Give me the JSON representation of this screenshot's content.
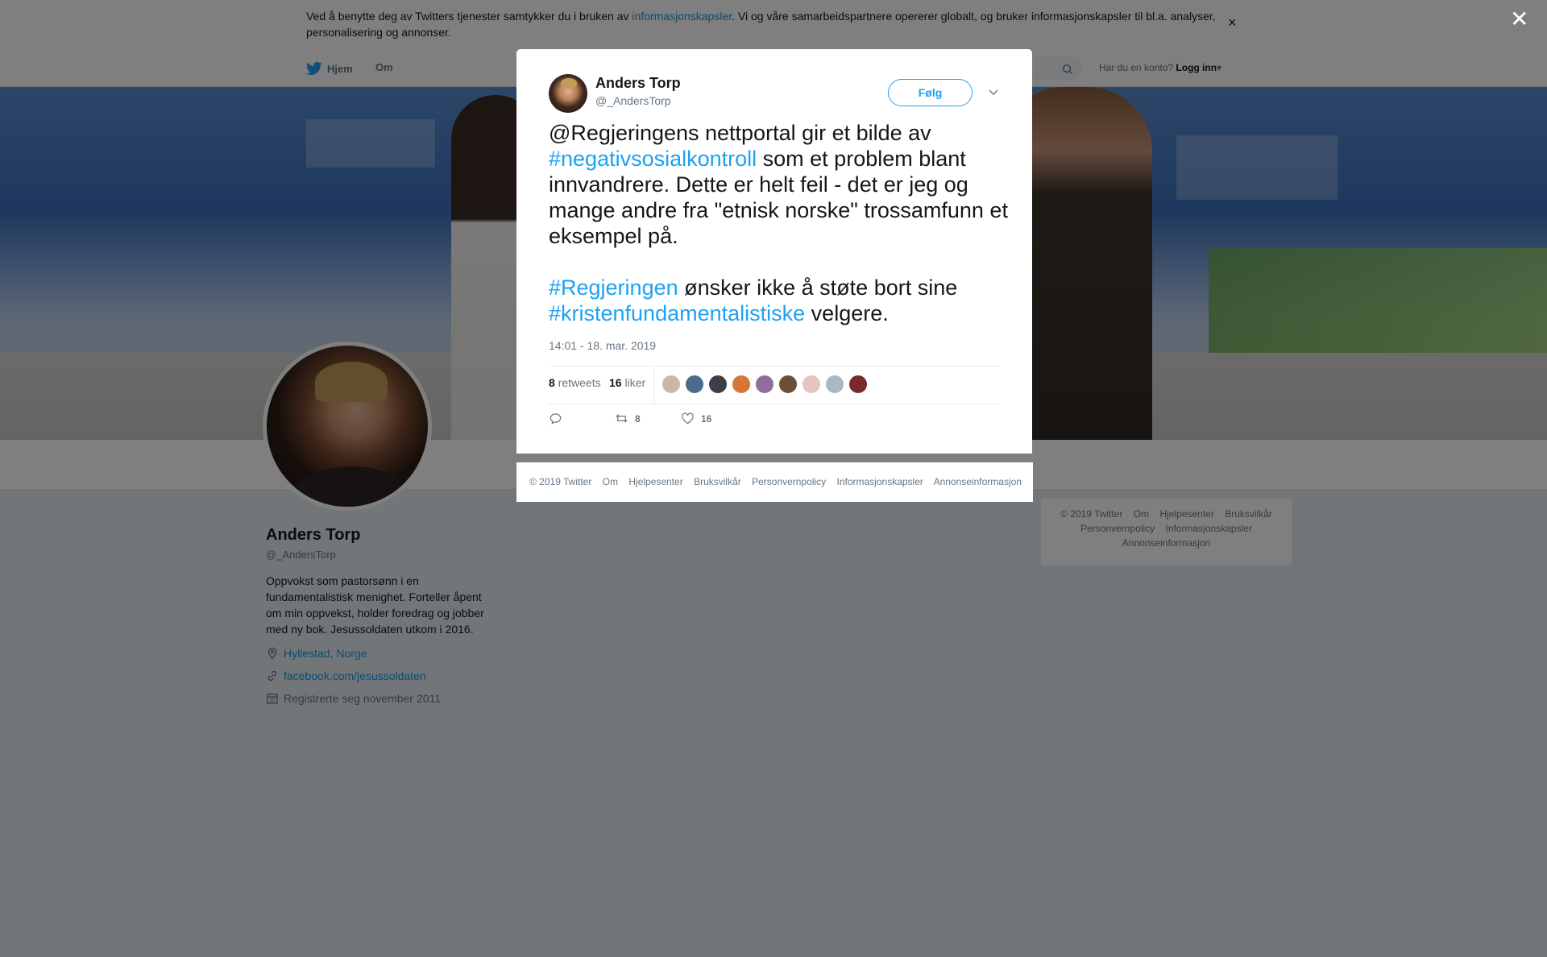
{
  "cookie_bar": {
    "text_before": "Ved å benytte deg av Twitters tjenester samtykker du i bruken av ",
    "link": "informasjonskapsler",
    "text_after": ". Vi og våre samarbeidspartnere opererer globalt, og bruker informasjonskapsler til bl.a. analyser, personalisering og annonser.",
    "close_symbol": "×"
  },
  "nav": {
    "home_label": "Hjem",
    "about_label": "Om",
    "login_prompt": "Har du en konto?",
    "login_link": "Logg inn"
  },
  "profile": {
    "name": "Anders Torp",
    "handle": "@_AndersTorp",
    "bio": "Oppvokst som pastorsønn i en fundamentalistisk menighet. Forteller åpent om min oppvekst, holder foredrag og jobber med ny bok. Jesussoldaten utkom i 2016.",
    "location": "Hyllestad, Norge",
    "website": "facebook.com/jesussoldaten",
    "joined": "Registrerte seg november 2011"
  },
  "side_footer": {
    "items": [
      "© 2019 Twitter",
      "Om",
      "Hjelpesenter",
      "Bruksvilkår",
      "Personvernpolicy",
      "Informasjonskapsler",
      "Annonseinformasjon"
    ]
  },
  "overlay": {
    "close_symbol": "✕"
  },
  "tweet": {
    "author_name": "Anders Torp",
    "author_handle": "@_AndersTorp",
    "follow_label": "Følg",
    "text_segments": {
      "p1": "@Regjeringens nettportal gir et bilde av ",
      "h1": "#negativsosialkontroll",
      "p2": " som et problem blant innvandrere. Dette er helt feil - det er jeg og mange andre fra \"etnisk norske\" trossamfunn et eksempel på.",
      "h2": "#Regjeringen",
      "p3": " ønsker ikke å støte bort sine ",
      "h3": "#kristenfundamentalistiske",
      "p4": " velgere."
    },
    "timestamp": "14:01 - 18. mar. 2019",
    "retweets_count": "8",
    "retweets_label": "retweets",
    "likes_count": "16",
    "likes_label": "liker",
    "liker_colors": [
      "#c9b8a8",
      "#4a6b8c",
      "#3b3f47",
      "#d4763a",
      "#8f6e9e",
      "#6b4e35",
      "#e8c3c0",
      "#aab8c2",
      "#7a2a2a"
    ],
    "reply_count": "",
    "retweet_action_count": "8",
    "like_action_count": "16"
  },
  "modal_footer": {
    "items": [
      "© 2019 Twitter",
      "Om",
      "Hjelpesenter",
      "Bruksvilkår",
      "Personvernpolicy",
      "Informasjonskapsler",
      "Annonseinformasjon"
    ]
  },
  "colors": {
    "twitter_blue": "#1da1f2",
    "link_blue": "#1b95e0",
    "overlay": "rgba(0,0,0,0.5)"
  }
}
